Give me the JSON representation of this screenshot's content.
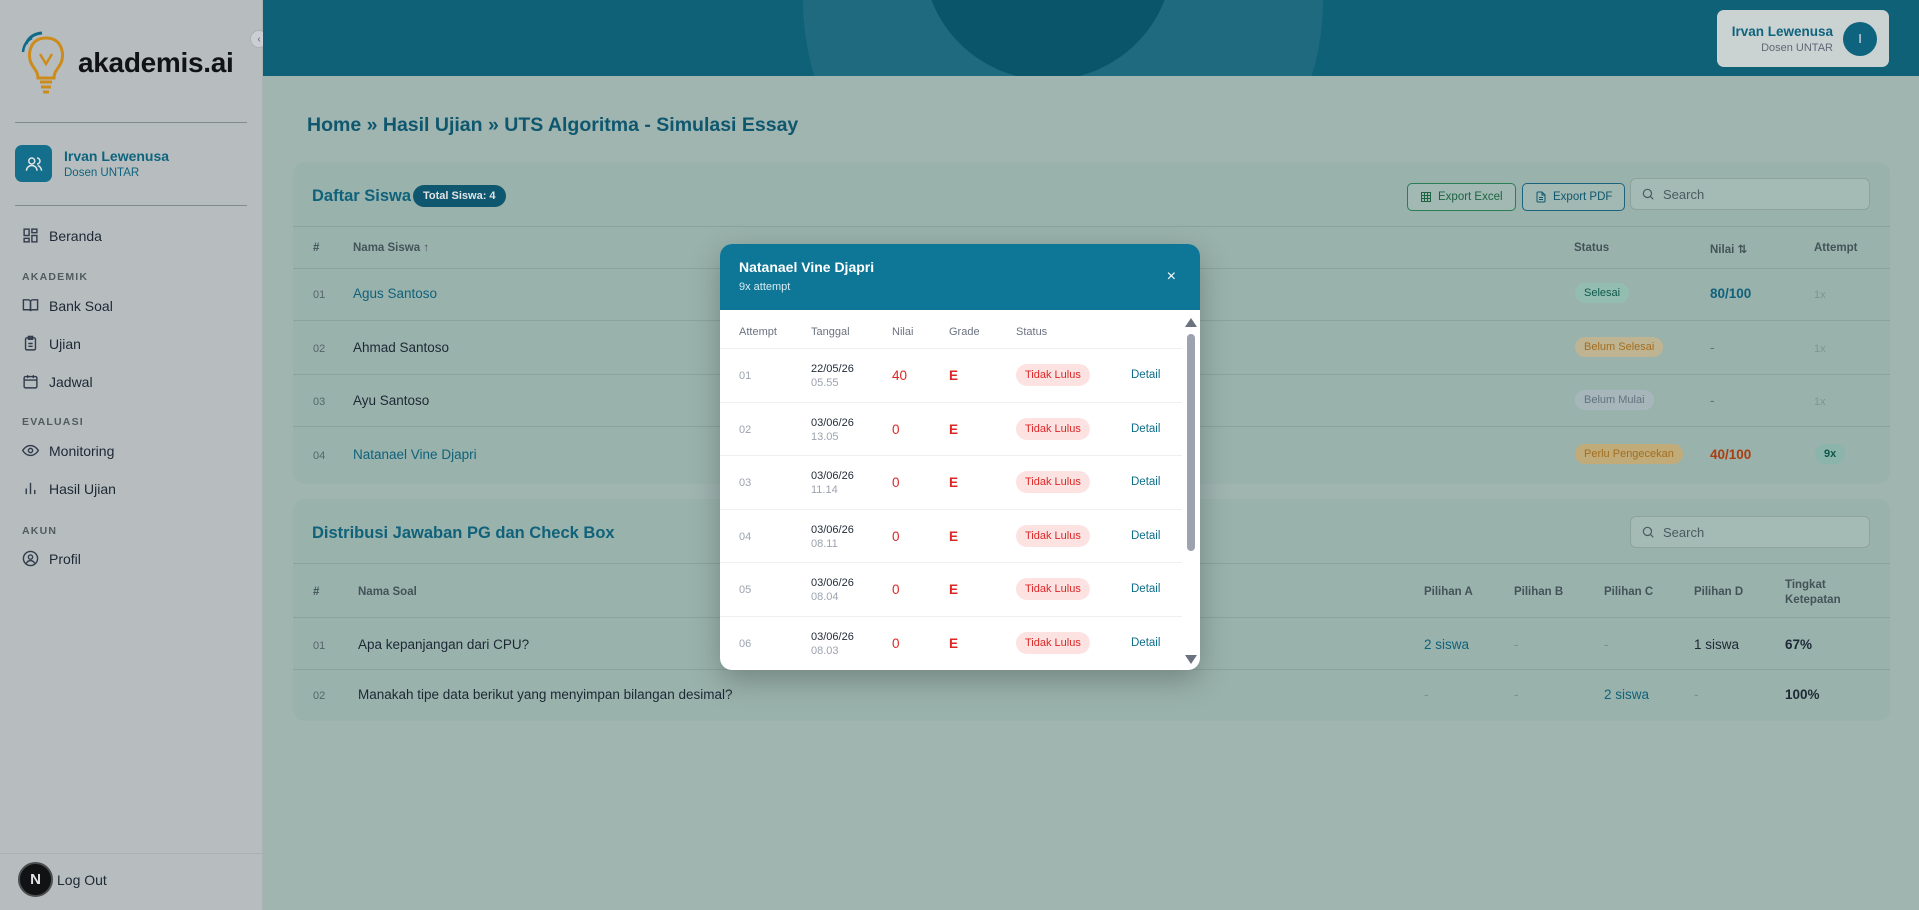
{
  "app": {
    "logo_text": "akademis.ai"
  },
  "sidebar": {
    "user": {
      "name": "Irvan Lewenusa",
      "role": "Dosen UNTAR"
    },
    "home": "Beranda",
    "sections": [
      {
        "label": "AKADEMIK",
        "items": [
          "Bank Soal",
          "Ujian",
          "Jadwal"
        ]
      },
      {
        "label": "EVALUASI",
        "items": [
          "Monitoring",
          "Hasil Ujian"
        ]
      },
      {
        "label": "AKUN",
        "items": [
          "Profil"
        ]
      }
    ],
    "logout": "Log Out",
    "n_badge": "N"
  },
  "header": {
    "user_name": "Irvan Lewenusa",
    "user_role": "Dosen UNTAR",
    "avatar_initial": "I"
  },
  "breadcrumb": "Home » Hasil Ujian » UTS Algoritma - Simulasi Essay",
  "students": {
    "title": "Daftar Siswa",
    "total_badge": "Total Siswa: 4",
    "export_excel": "Export Excel",
    "export_pdf": "Export PDF",
    "search_placeholder": "Search",
    "headers": {
      "no": "#",
      "name": "Nama Siswa ↑",
      "status": "Status",
      "nilai": "Nilai ⇅",
      "attempt": "Attempt"
    },
    "rows": [
      {
        "no": "01",
        "name": "Agus Santoso",
        "status": "Selesai",
        "nilai": "80/100",
        "attempt": "1x"
      },
      {
        "no": "02",
        "name": "Ahmad Santoso",
        "status": "Belum Selesai",
        "nilai": "-",
        "attempt": "1x"
      },
      {
        "no": "03",
        "name": "Ayu Santoso",
        "status": "Belum Mulai",
        "nilai": "-",
        "attempt": "1x"
      },
      {
        "no": "04",
        "name": "Natanael Vine Djapri",
        "status": "Perlu Pengecekan",
        "nilai": "40/100",
        "attempt": "9x"
      }
    ]
  },
  "distribution": {
    "title": "Distribusi Jawaban PG dan Check Box",
    "search_placeholder": "Search",
    "headers": {
      "no": "#",
      "soal": "Nama Soal",
      "a": "Pilihan A",
      "b": "Pilihan B",
      "c": "Pilihan C",
      "d": "Pilihan D",
      "acc1": "Tingkat",
      "acc2": "Ketepatan"
    },
    "rows": [
      {
        "no": "01",
        "soal": "Apa kepanjangan dari CPU?",
        "a": "2 siswa",
        "b": "-",
        "c": "-",
        "d": "1 siswa",
        "acc": "67%"
      },
      {
        "no": "02",
        "soal": "Manakah tipe data berikut yang menyimpan bilangan desimal?",
        "a": "-",
        "b": "-",
        "c": "2 siswa",
        "d": "-",
        "acc": "100%"
      }
    ]
  },
  "modal": {
    "title": "Natanael Vine Djapri",
    "subtitle": "9x attempt",
    "close": "×",
    "headers": {
      "attempt": "Attempt",
      "tanggal": "Tanggal",
      "nilai": "Nilai",
      "grade": "Grade",
      "status": "Status"
    },
    "rows": [
      {
        "no": "01",
        "date": "22/05/26",
        "time": "05.55",
        "nilai": "40",
        "grade": "E",
        "status": "Tidak Lulus",
        "detail": "Detail"
      },
      {
        "no": "02",
        "date": "03/06/26",
        "time": "13.05",
        "nilai": "0",
        "grade": "E",
        "status": "Tidak Lulus",
        "detail": "Detail"
      },
      {
        "no": "03",
        "date": "03/06/26",
        "time": "11.14",
        "nilai": "0",
        "grade": "E",
        "status": "Tidak Lulus",
        "detail": "Detail"
      },
      {
        "no": "04",
        "date": "03/06/26",
        "time": "08.11",
        "nilai": "0",
        "grade": "E",
        "status": "Tidak Lulus",
        "detail": "Detail"
      },
      {
        "no": "05",
        "date": "03/06/26",
        "time": "08.04",
        "nilai": "0",
        "grade": "E",
        "status": "Tidak Lulus",
        "detail": "Detail"
      },
      {
        "no": "06",
        "date": "03/06/26",
        "time": "08.03",
        "nilai": "0",
        "grade": "E",
        "status": "Tidak Lulus",
        "detail": "Detail"
      }
    ]
  },
  "colors": {
    "brand": "#0e7696",
    "danger": "#dc2626",
    "success_bg": "#d1fae5"
  }
}
